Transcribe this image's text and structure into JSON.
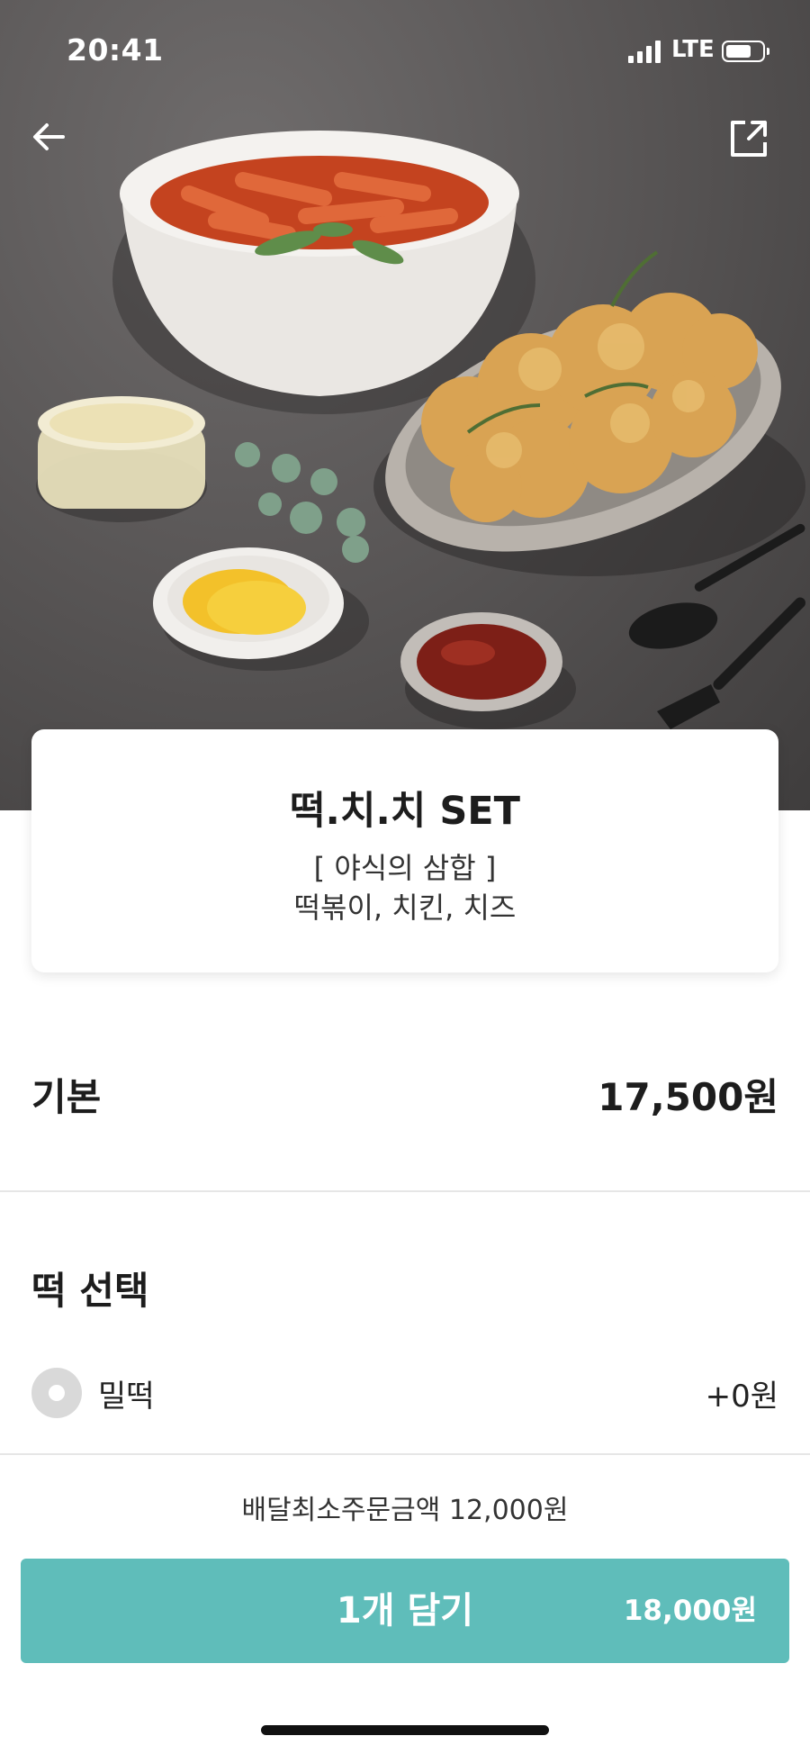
{
  "status_bar": {
    "time": "20:41",
    "network": "LTE",
    "battery_level": 0.7
  },
  "header": {
    "back_icon": "arrow-left-icon",
    "share_icon": "share-icon"
  },
  "product": {
    "name": "떡.치.치 SET",
    "tagline": "[ 야식의 삼합 ]",
    "components": "떡볶이, 치킨, 치즈"
  },
  "base": {
    "label": "기본",
    "price": "17,500원"
  },
  "option_group": {
    "title": "떡 선택",
    "options": [
      {
        "label": "밀떡",
        "price": "+0원"
      }
    ]
  },
  "order": {
    "min_order_text": "배달최소주문금액 12,000원",
    "cart_button_label": "1개 담기",
    "cart_button_price": "18,000원"
  },
  "colors": {
    "accent": "#5fbdba",
    "radio": "#d9d9d9"
  }
}
